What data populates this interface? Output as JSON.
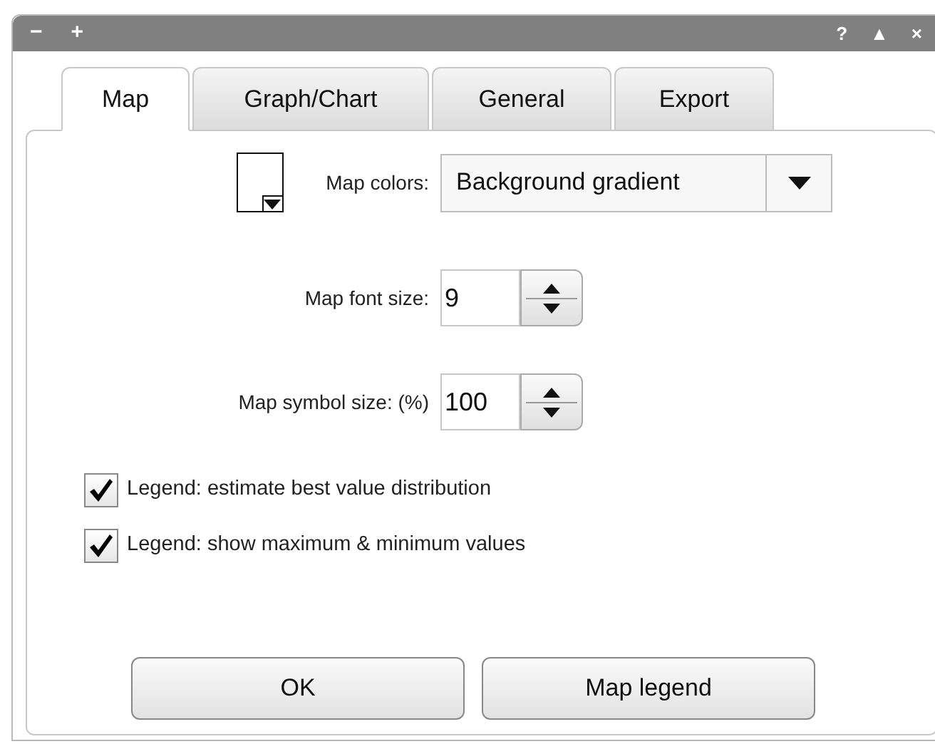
{
  "window": {
    "left_controls": [
      "−",
      "+"
    ],
    "right_controls": [
      "?",
      "▲",
      "×"
    ]
  },
  "tabs": [
    {
      "label": "Map",
      "selected": true
    },
    {
      "label": "Graph/Chart",
      "selected": false
    },
    {
      "label": "General",
      "selected": false
    },
    {
      "label": "Export",
      "selected": false
    }
  ],
  "map_colors": {
    "label": "Map colors:",
    "value": "Background gradient"
  },
  "spinners": [
    {
      "label": "Map font size:",
      "value": "9"
    },
    {
      "label": "Map symbol size: (%)",
      "value": "100"
    }
  ],
  "checkboxes": [
    {
      "label": "Legend: estimate best value distribution",
      "checked": true
    },
    {
      "label": "Legend: show maximum & minimum values",
      "checked": true
    }
  ],
  "buttons": [
    "OK",
    "Map legend"
  ]
}
